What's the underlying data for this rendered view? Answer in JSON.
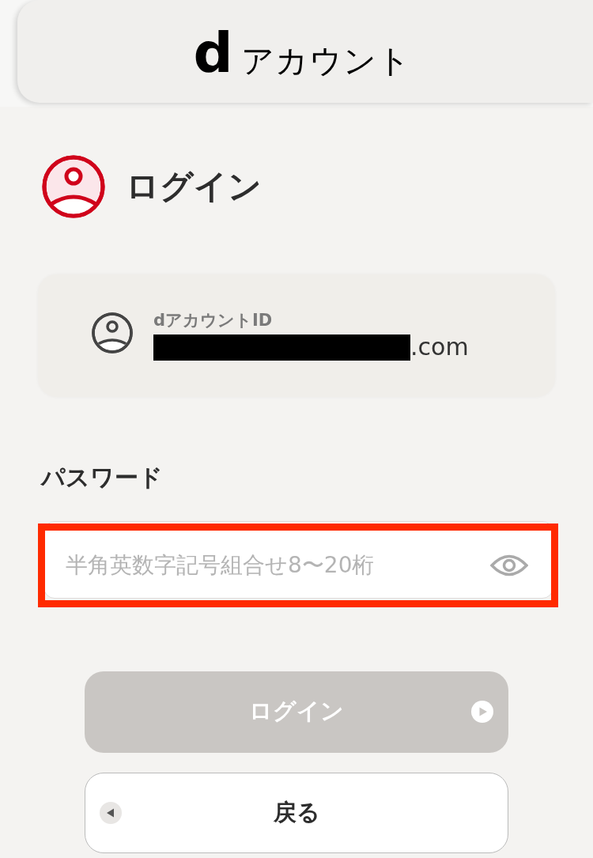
{
  "header": {
    "logo": {
      "mark": "d",
      "text": "アカウント"
    }
  },
  "page_title": "ログイン",
  "account": {
    "label": "dアカウントID",
    "value": ".com",
    "redacted": true
  },
  "password": {
    "label": "パスワード",
    "placeholder": "半角英数字記号組合せ8〜20桁",
    "highlighted": true
  },
  "buttons": [
    {
      "kind": "submit",
      "label": "ログイン",
      "disabled": true
    },
    {
      "kind": "back",
      "label": "戻る",
      "disabled": false
    }
  ]
}
